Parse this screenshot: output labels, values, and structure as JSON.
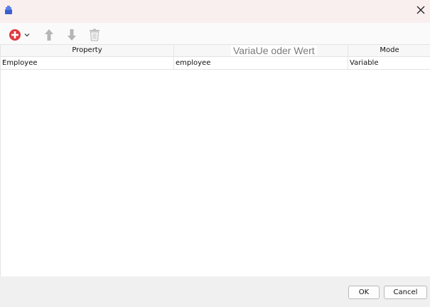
{
  "window": {
    "icons": {
      "app": "bell-app-icon",
      "close": "close-icon"
    }
  },
  "toolbar": {
    "add_icon": "add-circle-icon",
    "add_menu_icon": "chevron-down-icon",
    "move_up_icon": "arrow-up-icon",
    "move_down_icon": "arrow-down-icon",
    "delete_icon": "trash-icon"
  },
  "table": {
    "headers": {
      "property": "Property",
      "value": "VariaUe oder Wert",
      "mode": "Mode"
    },
    "rows": [
      {
        "property": "Employee",
        "value": "employee",
        "mode": "Variable"
      }
    ]
  },
  "footer": {
    "ok_label": "OK",
    "cancel_label": "Cancel"
  },
  "colors": {
    "titlebar": "#f9efef",
    "add_icon": "#e03a3e",
    "app_icon": "#3b5fcf"
  }
}
